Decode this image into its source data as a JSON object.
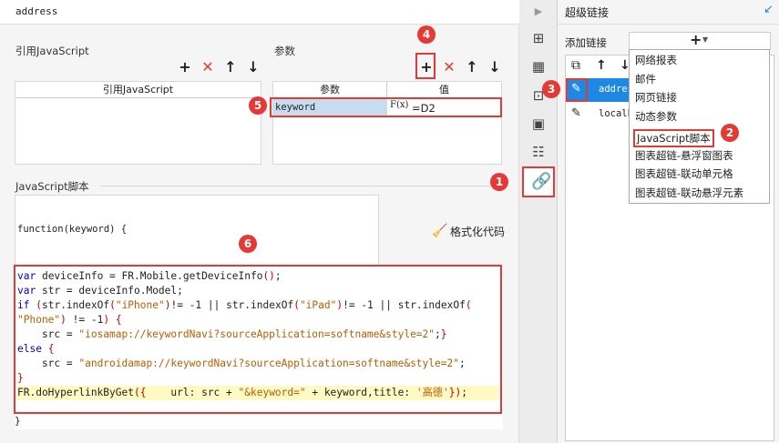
{
  "address_bar": {
    "text": "address"
  },
  "ref_js": {
    "label": "引用JavaScript",
    "column_header": "引用JavaScript"
  },
  "params": {
    "label": "参数",
    "col_param": "参数",
    "col_value": "值",
    "row": {
      "param": "keyword",
      "fx": "F(x)",
      "value": "=D2"
    }
  },
  "script": {
    "label": "JavaScript脚本",
    "header": "function(keyword) {",
    "format_label": "格式化代码",
    "footer": "}",
    "lines": [
      "var deviceInfo = FR.Mobile.getDeviceInfo();",
      "var str = deviceInfo.Model;",
      "if (str.indexOf(\"iPhone\")!= -1 || str.indexOf(\"iPad\")!= -1 || str.indexOf(",
      "\"Phone\") != -1) {",
      "    src = \"iosamap://keywordNavi?sourceApplication=softname&style=2\";}",
      "else {",
      "    src = \"androidamap://keywordNavi?sourceApplication=softname&style=2\";",
      "}",
      "FR.doHyperlinkByGet({    url: src + \"&keyword=\" + keyword,title: '高德'});"
    ]
  },
  "hyperlink_panel": {
    "title": "超级链接",
    "add_label": "添加链接",
    "list_items": [
      "address",
      "localh"
    ],
    "menu": [
      "网络报表",
      "邮件",
      "网页链接",
      "动态参数",
      "JavaScript脚本",
      "图表超链-悬浮窗图表",
      "图表超链-联动单元格",
      "图表超链-联动悬浮元素"
    ]
  },
  "markers": [
    "1",
    "2",
    "3",
    "4",
    "5",
    "6"
  ],
  "colors": {
    "marker": "#e53935",
    "selected_row": "#1e88e5",
    "param_cell": "#c8dcf0"
  }
}
